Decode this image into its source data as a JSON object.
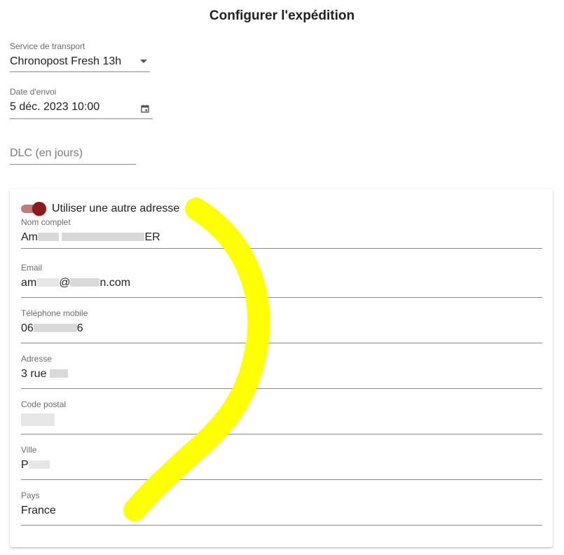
{
  "title": "Configurer l'expédition",
  "transport": {
    "label": "Service de transport",
    "value": "Chronopost Fresh 13h"
  },
  "send_date": {
    "label": "Date d'envoi",
    "value": "5 déc. 2023 10:00"
  },
  "dlc": {
    "placeholder": "DLC (en jours)"
  },
  "address_card": {
    "toggle_label": "Utiliser une autre adresse",
    "toggle_on": true,
    "full_name": {
      "label": "Nom complet",
      "prefix": "Am",
      "suffix": "ER"
    },
    "email": {
      "label": "Email",
      "prefix": "am",
      "middle": "@",
      "suffix": "n.com"
    },
    "mobile": {
      "label": "Téléphone mobile",
      "prefix": "06",
      "suffix": "6"
    },
    "address": {
      "label": "Adresse",
      "prefix": "3 rue"
    },
    "postal_code": {
      "label": "Code postal"
    },
    "city": {
      "label": "Ville",
      "prefix": "P"
    },
    "country": {
      "label": "Pays",
      "value": "France"
    }
  },
  "colors": {
    "toggle_track": "#c27b7b",
    "toggle_thumb": "#8b1a1a",
    "annotation_stroke": "#ffff00"
  },
  "icons": {
    "select": "chevron-down-icon",
    "date": "calendar-icon"
  }
}
